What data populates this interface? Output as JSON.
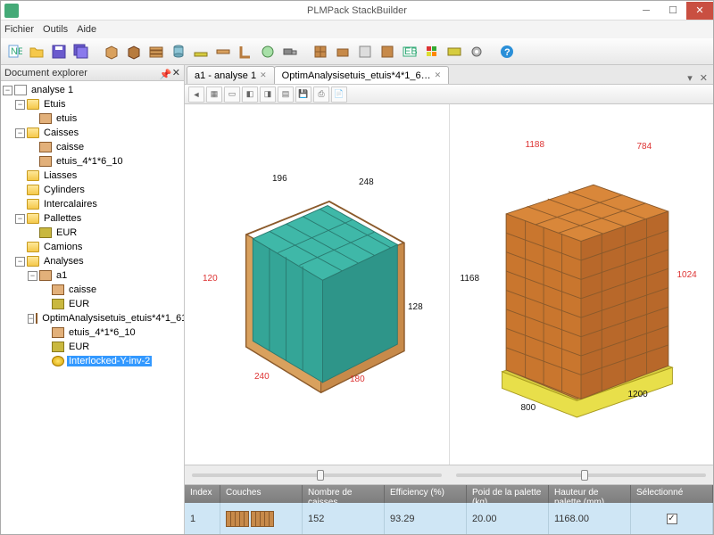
{
  "window": {
    "title": "PLMPack StackBuilder"
  },
  "menu": [
    "Fichier",
    "Outils",
    "Aide"
  ],
  "explorer": {
    "title": "Document explorer"
  },
  "tree": {
    "root": "analyse 1",
    "etuis": "Etuis",
    "etuis_item": "etuis",
    "caisses": "Caisses",
    "caisse": "caisse",
    "etuis_4": "etuis_4*1*6_10",
    "liasses": "Liasses",
    "cylinders": "Cylinders",
    "intercalaires": "Intercalaires",
    "pallettes": "Pallettes",
    "eur": "EUR",
    "camions": "Camions",
    "analyses": "Analyses",
    "a1": "a1",
    "a1_caisse": "caisse",
    "a1_eur": "EUR",
    "optim": "OptimAnalysisetuis_etuis*4*1_61",
    "optim_etuis": "etuis_4*1*6_10",
    "optim_eur": "EUR",
    "selected": "Interlocked-Y-inv-2"
  },
  "tabs": [
    {
      "label": "a1 - analyse 1"
    },
    {
      "label": "OptimAnalysisetuis_etuis*4*1_6…"
    }
  ],
  "left_view": {
    "d_top1": "196",
    "d_top2": "248",
    "d_in_h": "120",
    "d_out_h": "128",
    "d_bot1": "240",
    "d_bot2": "180"
  },
  "right_view": {
    "d_top1": "1188",
    "d_top2": "784",
    "d_in_h": "1168",
    "d_out_h": "1024",
    "d_bot1": "800",
    "d_bot2": "1200"
  },
  "table": {
    "headers": [
      "Index",
      "Couches",
      "Nombre de caisses",
      "Efficiency (%)",
      "Poid de la palette (kg)",
      "Hauteur de palette (mm)",
      "Sélectionné"
    ],
    "row": {
      "index": "1",
      "nombre": "152",
      "eff": "93.29",
      "poids": "20.00",
      "hauteur": "1168.00"
    }
  }
}
